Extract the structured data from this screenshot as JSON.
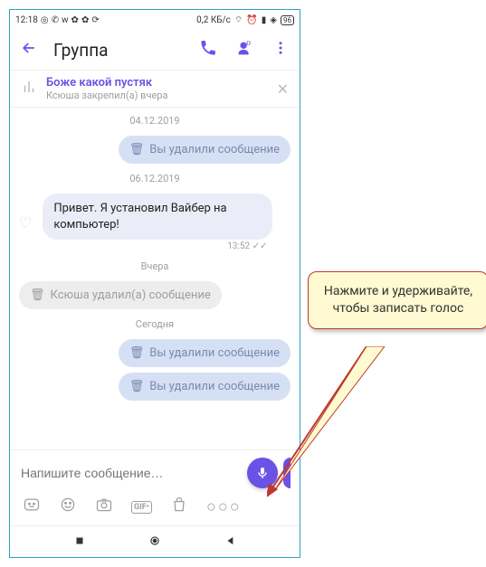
{
  "statusbar": {
    "time": "12:18",
    "net_speed": "0,2 КБ/с",
    "battery": "96"
  },
  "header": {
    "title": "Группа"
  },
  "pinned": {
    "title": "Боже какой пустяк",
    "subtitle": "Ксюша закрепил(а) вчера"
  },
  "dates": {
    "d1": "04.12.2019",
    "d2": "06.12.2019",
    "d3": "Вчера",
    "d4": "Сегодня"
  },
  "messages": {
    "deleted_you": "Вы удалили сообщение",
    "incoming1": "Привет. Я установил Вайбер на компьютер!",
    "incoming1_time": "13:52",
    "deleted_ksyusha": "Ксюша удалил(а) сообщение"
  },
  "input": {
    "placeholder": "Напишите сообщение…"
  },
  "callout": {
    "text": "Нажмите и удерживайте, чтобы записать голос"
  }
}
